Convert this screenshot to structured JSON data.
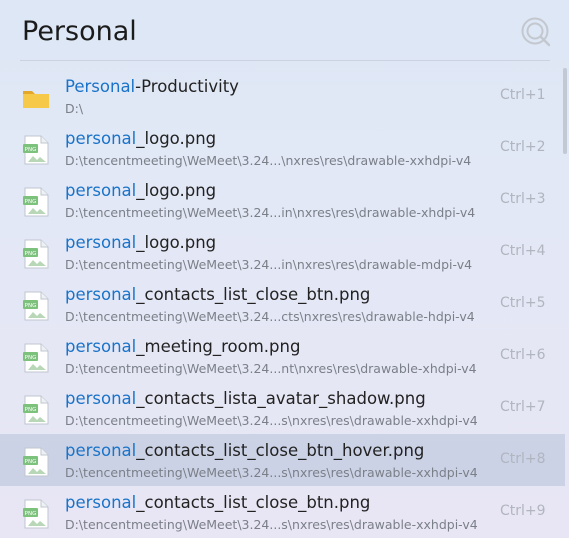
{
  "search": {
    "query": "Personal"
  },
  "results": [
    {
      "match": "Personal",
      "rest": "-Productivity",
      "path": "D:\\",
      "shortcut": "Ctrl+1",
      "icon": "folder-icon"
    },
    {
      "match": "personal",
      "rest": "_logo.png",
      "path": "D:\\tencentmeeting\\WeMeet\\3.24...\\nxres\\res\\drawable-xxhdpi-v4",
      "shortcut": "Ctrl+2",
      "icon": "png-file-icon"
    },
    {
      "match": "personal",
      "rest": "_logo.png",
      "path": "D:\\tencentmeeting\\WeMeet\\3.24...in\\nxres\\res\\drawable-xhdpi-v4",
      "shortcut": "Ctrl+3",
      "icon": "png-file-icon"
    },
    {
      "match": "personal",
      "rest": "_logo.png",
      "path": "D:\\tencentmeeting\\WeMeet\\3.24...in\\nxres\\res\\drawable-mdpi-v4",
      "shortcut": "Ctrl+4",
      "icon": "png-file-icon"
    },
    {
      "match": "personal",
      "rest": "_contacts_list_close_btn.png",
      "path": "D:\\tencentmeeting\\WeMeet\\3.24...cts\\nxres\\res\\drawable-hdpi-v4",
      "shortcut": "Ctrl+5",
      "icon": "png-file-icon"
    },
    {
      "match": "personal",
      "rest": "_meeting_room.png",
      "path": "D:\\tencentmeeting\\WeMeet\\3.24...nt\\nxres\\res\\drawable-xhdpi-v4",
      "shortcut": "Ctrl+6",
      "icon": "png-file-icon"
    },
    {
      "match": "personal",
      "rest": "_contacts_lista_avatar_shadow.png",
      "path": "D:\\tencentmeeting\\WeMeet\\3.24...s\\nxres\\res\\drawable-xxhdpi-v4",
      "shortcut": "Ctrl+7",
      "icon": "png-file-icon"
    },
    {
      "match": "personal",
      "rest": "_contacts_list_close_btn_hover.png",
      "path": "D:\\tencentmeeting\\WeMeet\\3.24...s\\nxres\\res\\drawable-xxhdpi-v4",
      "shortcut": "Ctrl+8",
      "icon": "png-file-icon"
    },
    {
      "match": "personal",
      "rest": "_contacts_list_close_btn.png",
      "path": "D:\\tencentmeeting\\WeMeet\\3.24...s\\nxres\\res\\drawable-xxhdpi-v4",
      "shortcut": "Ctrl+9",
      "icon": "png-file-icon"
    }
  ],
  "selected_shortcut": "Ctrl+8",
  "colors": {
    "match_highlight": "#1a73c9",
    "folder": "#f5c342",
    "png_badge": "#7cc27c"
  }
}
